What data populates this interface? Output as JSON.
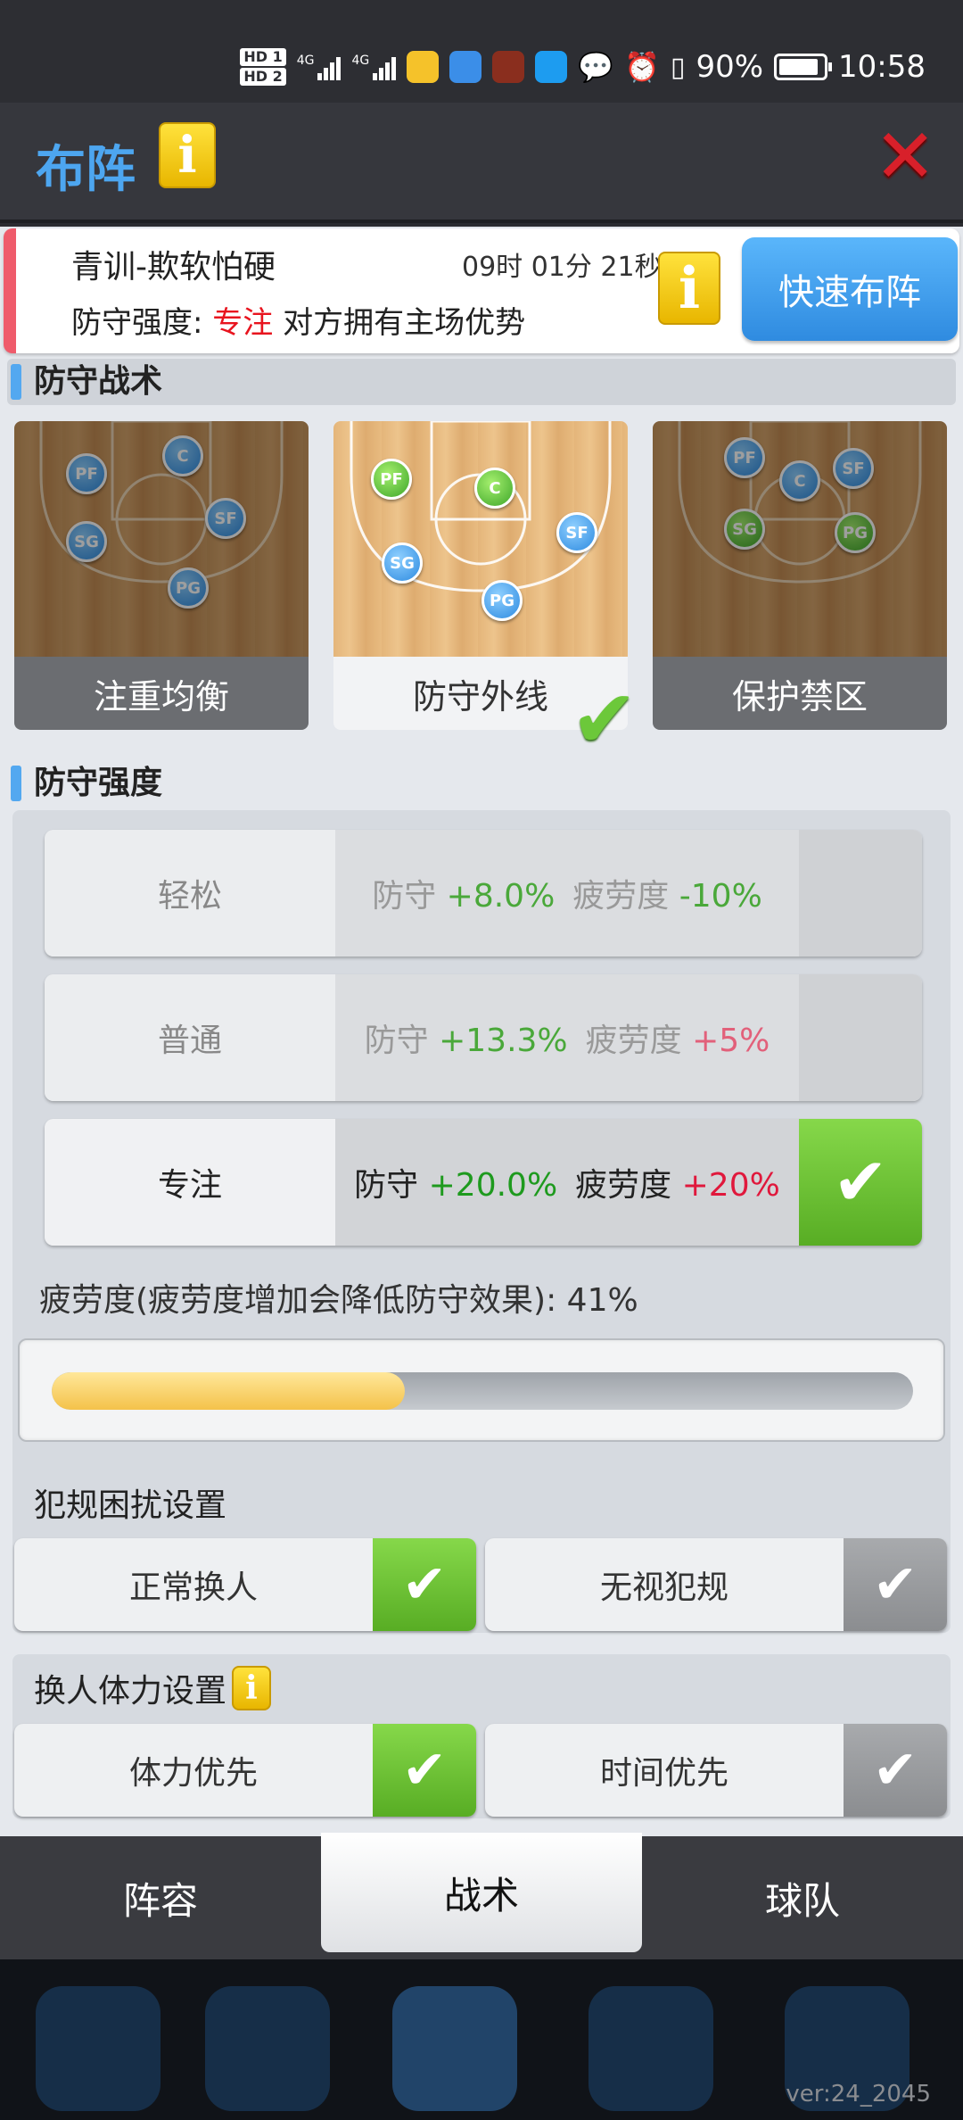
{
  "status_bar": {
    "hd1": "HD 1",
    "hd2": "HD 2",
    "network1": "4G",
    "network2": "4G",
    "battery": "90%",
    "time": "10:58"
  },
  "header": {
    "title": "布阵",
    "info_icon": "i",
    "close_icon": "✕"
  },
  "mission": {
    "name": "青训-欺软怕硬",
    "timer": "09时 01分 21秒",
    "intensity_prefix": "防守强度:",
    "intensity_value": "专注",
    "intensity_suffix": "对方拥有主场优势",
    "info_icon": "i",
    "quick_button": "快速布阵"
  },
  "defense_tactics": {
    "title": "防守战术",
    "cards": [
      {
        "label": "注重均衡",
        "selected": false
      },
      {
        "label": "防守外线",
        "selected": true
      },
      {
        "label": "保护禁区",
        "selected": false
      }
    ],
    "positions": {
      "pf": "PF",
      "c": "C",
      "sf": "SF",
      "sg": "SG",
      "pg": "PG"
    },
    "check": "✔"
  },
  "defense_intensity": {
    "title": "防守强度",
    "def_label": "防守",
    "fatigue_label": "疲劳度",
    "levels": [
      {
        "label": "轻松",
        "def": "+8.0%",
        "fatigue": "-10%",
        "selected": false
      },
      {
        "label": "普通",
        "def": "+13.3%",
        "fatigue": "+5%",
        "selected": false
      },
      {
        "label": "专注",
        "def": "+20.0%",
        "fatigue": "+20%",
        "selected": true
      }
    ],
    "fatigue_text": "疲劳度(疲劳度增加会降低防守效果): 41%",
    "fatigue_value": 0.41,
    "check": "✔"
  },
  "foul_settings": {
    "title": "犯规困扰设置",
    "options": [
      {
        "label": "正常换人",
        "selected": true
      },
      {
        "label": "无视犯规",
        "selected": false
      }
    ]
  },
  "stamina_settings": {
    "title": "换人体力设置",
    "info_icon": "i",
    "options": [
      {
        "label": "体力优先",
        "selected": true
      },
      {
        "label": "时间优先",
        "selected": false
      }
    ]
  },
  "tabs": [
    {
      "label": "阵容",
      "active": false
    },
    {
      "label": "战术",
      "active": true
    },
    {
      "label": "球队",
      "active": false
    }
  ],
  "version": "ver:24_2045",
  "colors": {
    "accent_blue": "#4da6f0",
    "green_check": "#6cc83a",
    "red": "#e8141e"
  }
}
